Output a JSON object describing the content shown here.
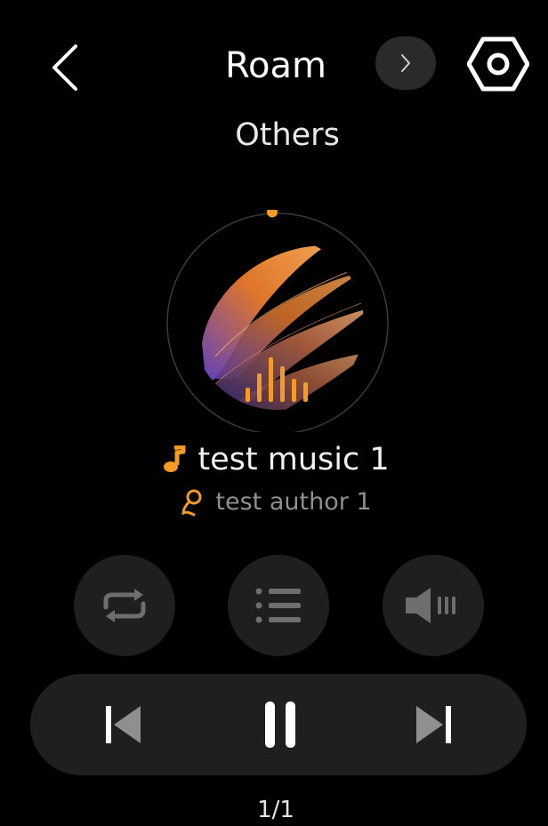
{
  "header": {
    "title": "Roam",
    "subtitle": "Others",
    "back_icon": "chevron-left-icon",
    "next_source_icon": "chevron-right-icon",
    "settings_icon": "hex-settings-icon"
  },
  "now_playing": {
    "title": "test music 1",
    "author": "test author 1",
    "title_icon": "music-note-icon",
    "author_icon": "singer-icon",
    "cover_icon": "album-art",
    "progress": 0.0
  },
  "actions": {
    "repeat_icon": "repeat-icon",
    "playlist_icon": "playlist-icon",
    "volume_icon": "volume-icon"
  },
  "transport": {
    "prev_icon": "skip-previous-icon",
    "play_pause_icon": "pause-icon",
    "next_icon": "skip-next-icon"
  },
  "pager": {
    "text": "1/1"
  },
  "colors": {
    "accent": "#f59a23",
    "background": "#000000",
    "button_bg": "#1f1f1f",
    "muted_text": "#8f8f8f"
  }
}
